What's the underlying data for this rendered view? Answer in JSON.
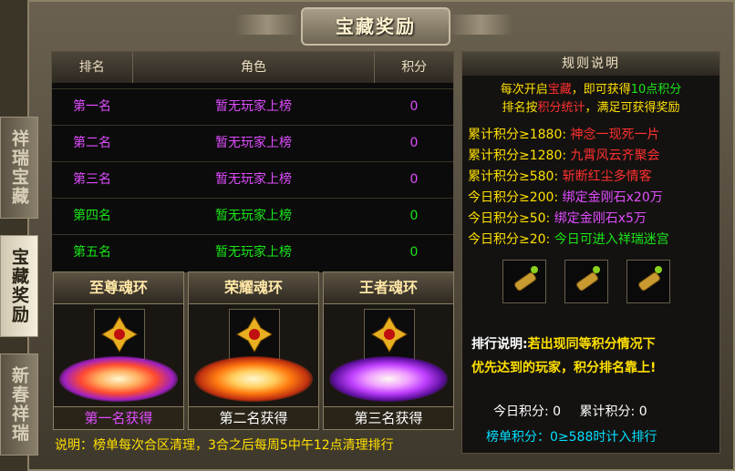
{
  "header": {
    "title": "宝藏奖励"
  },
  "side_tabs": [
    {
      "label": "祥瑞宝藏",
      "active": false
    },
    {
      "label": "宝藏奖励",
      "active": true
    },
    {
      "label": "新春祥瑞",
      "active": false
    }
  ],
  "table": {
    "headers": [
      "排名",
      "角色",
      "积分"
    ],
    "rows": [
      {
        "rank": "第一名",
        "role": "暂无玩家上榜",
        "score": "0",
        "color": "#e04cff"
      },
      {
        "rank": "第二名",
        "role": "暂无玩家上榜",
        "score": "0",
        "color": "#e04cff"
      },
      {
        "rank": "第三名",
        "role": "暂无玩家上榜",
        "score": "0",
        "color": "#e04cff"
      },
      {
        "rank": "第四名",
        "role": "暂无玩家上榜",
        "score": "0",
        "color": "#19e619"
      },
      {
        "rank": "第五名",
        "role": "暂无玩家上榜",
        "score": "0",
        "color": "#19e619"
      }
    ]
  },
  "rings": [
    {
      "title": "至尊魂环",
      "label": "第一名获得",
      "label_color": "#e04cff",
      "glow": "#ff5a20"
    },
    {
      "title": "荣耀魂环",
      "label": "第二名获得",
      "label_color": "#ffffff",
      "glow": "#ff7a10"
    },
    {
      "title": "王者魂环",
      "label": "第三名获得",
      "label_color": "#ffffff",
      "glow": "#c040ff"
    }
  ],
  "note": "说明：榜单每次合区清理，3合之后每周5中午12点清理排行",
  "rules": {
    "title": "规则说明",
    "line1_a": "每次开启",
    "line1_b": "宝藏",
    "line1_c": "，即可获得",
    "line1_d": "10点积分",
    "line2_a": "排名按",
    "line2_b": "积分统计",
    "line2_c": "，满足可获得奖励",
    "tiers": [
      {
        "cond": "累计积分≥1880:",
        "reward": "神念一现死一片"
      },
      {
        "cond": "累计积分≥1280:",
        "reward": "九霄风云齐聚会"
      },
      {
        "cond": "累计积分≥580:",
        "reward": "斩断红尘多情客"
      },
      {
        "cond": "今日积分≥200:",
        "reward": "绑定金刚石x20万"
      },
      {
        "cond": "今日积分≥50:",
        "reward": "绑定金刚石x5万"
      },
      {
        "cond": "今日积分≥20:",
        "reward": "今日可进入祥瑞迷宫"
      }
    ],
    "rank_note_label": "排行说明:",
    "rank_note_a": "若出现同等积分情况下",
    "rank_note_b": "优先达到的玩家，积分排名靠上!",
    "today_label": "今日积分:",
    "today_value": "0",
    "total_label": "累计积分:",
    "total_value": "0",
    "board_note": "榜单积分：0≥588时计入排行"
  },
  "colors": {
    "yellow": "#ffe000",
    "red": "#ff3030",
    "green": "#19e619",
    "cyan": "#00e0ff"
  }
}
